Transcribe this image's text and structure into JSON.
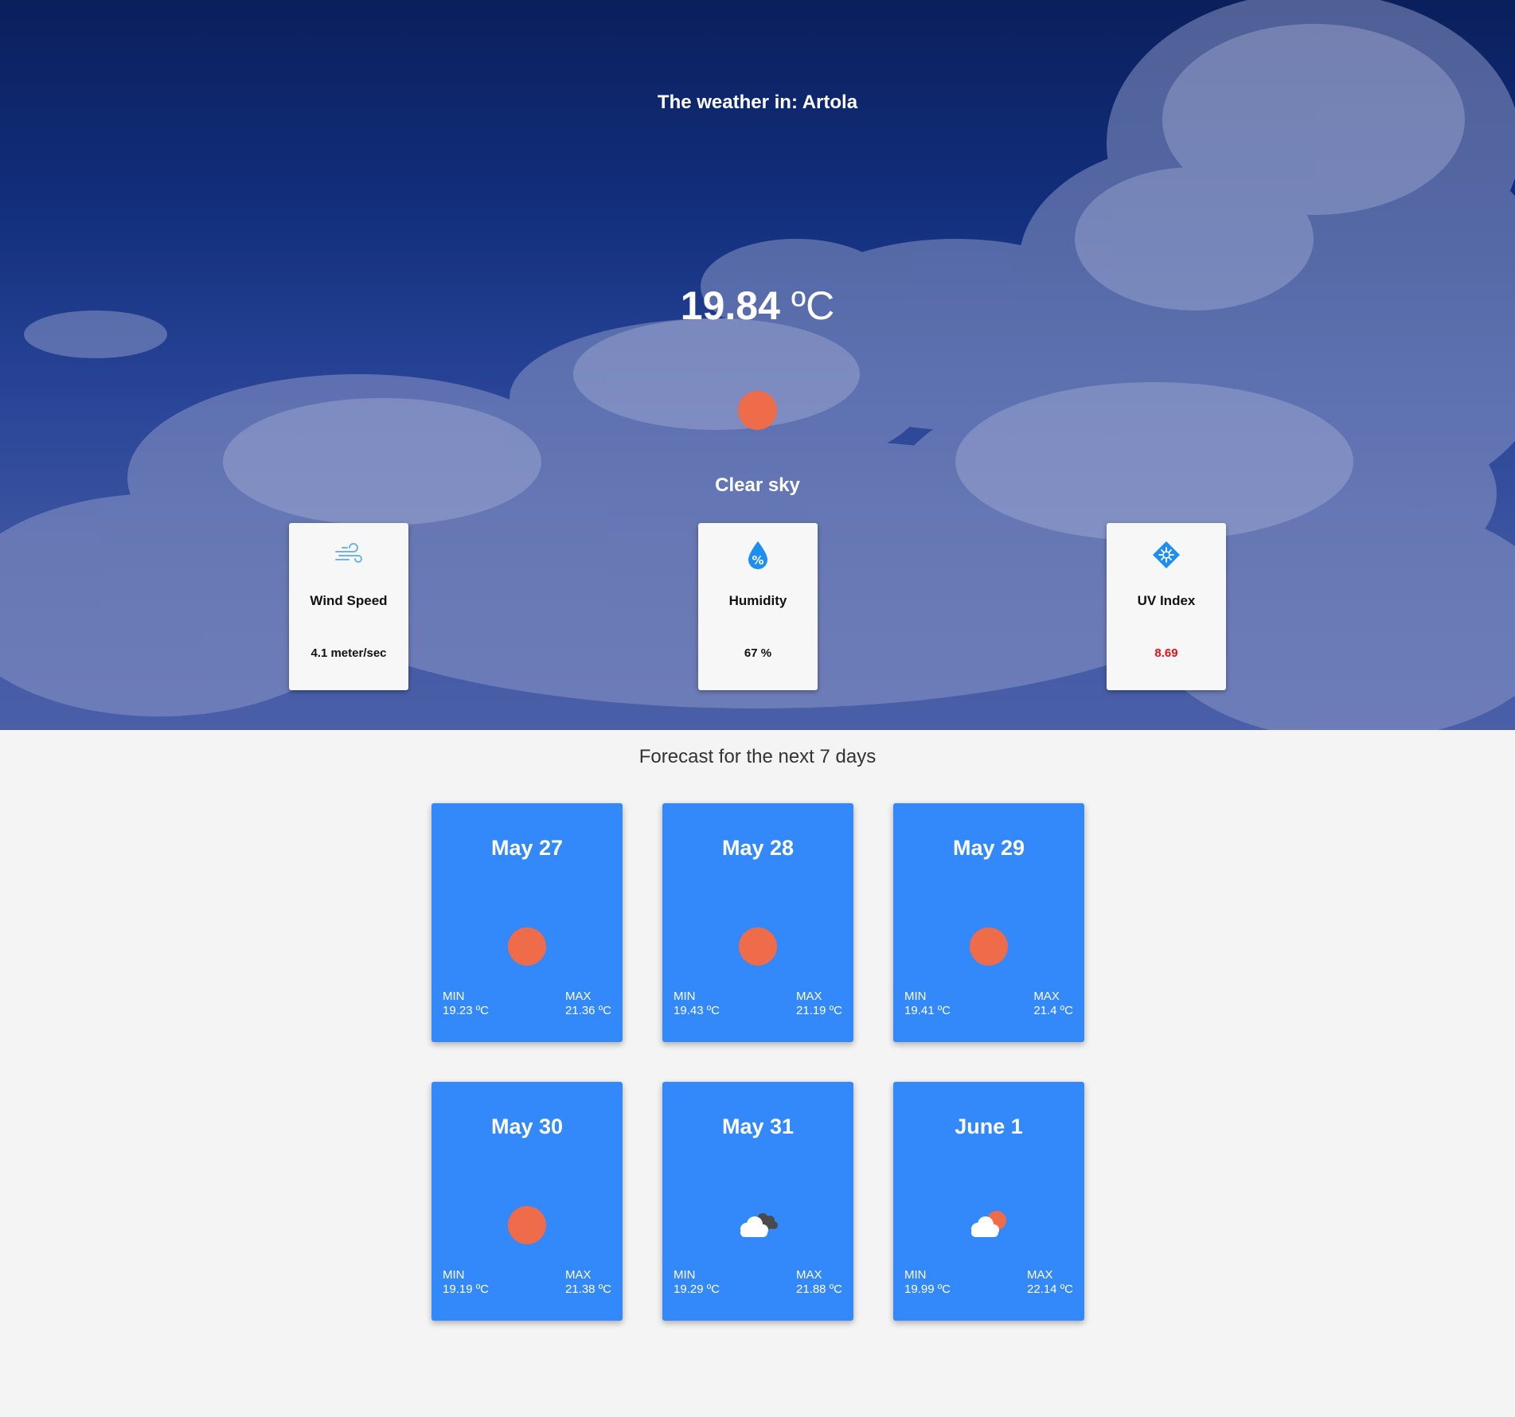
{
  "header": {
    "title": "The weather in: Artola",
    "temperature": "19.84",
    "unit": " ºC",
    "description": "Clear sky",
    "icon": "sun-icon"
  },
  "stats": [
    {
      "label": "Wind Speed",
      "value": "4.1 meter/sec",
      "icon": "wind-icon"
    },
    {
      "label": "Humidity",
      "value": "67 %",
      "icon": "humidity-drop-icon"
    },
    {
      "label": "UV Index",
      "value": "8.69",
      "icon": "uv-snowflake-icon",
      "value_color": "#e8101c"
    }
  ],
  "forecast": {
    "title": "Forecast for the next 7 days",
    "min_label": "MIN",
    "max_label": "MAX",
    "days": [
      {
        "date": "May 27",
        "min": "19.23 ºC",
        "max": "21.36 ºC",
        "icon": "sun-icon"
      },
      {
        "date": "May 28",
        "min": "19.43 ºC",
        "max": "21.19 ºC",
        "icon": "sun-icon"
      },
      {
        "date": "May 29",
        "min": "19.41 ºC",
        "max": "21.4 ºC",
        "icon": "sun-icon"
      },
      {
        "date": "May 30",
        "min": "19.19 ºC",
        "max": "21.38 ºC",
        "icon": "sun-icon"
      },
      {
        "date": "May 31",
        "min": "19.29 ºC",
        "max": "21.88 ºC",
        "icon": "dark-cloud-icon"
      },
      {
        "date": "June 1",
        "min": "19.99 ºC",
        "max": "22.14 ºC",
        "icon": "sun-behind-cloud-icon"
      }
    ]
  },
  "colors": {
    "card_blue": "#3388fa",
    "sun_orange": "#ef6c4a",
    "uv_red": "#e8101c"
  }
}
